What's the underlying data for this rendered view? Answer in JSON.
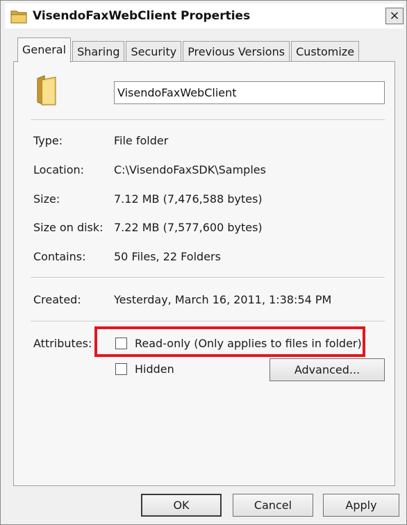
{
  "window": {
    "title": "VisendoFaxWebClient Properties",
    "close_label": "×",
    "title_icon": "folder-icon"
  },
  "tabs": [
    {
      "label": "General",
      "active": true
    },
    {
      "label": "Sharing",
      "active": false
    },
    {
      "label": "Security",
      "active": false
    },
    {
      "label": "Previous Versions",
      "active": false
    },
    {
      "label": "Customize",
      "active": false
    }
  ],
  "general": {
    "icon": "folder-icon",
    "name_value": "VisendoFaxWebClient",
    "properties": [
      {
        "label": "Type:",
        "value": "File folder"
      },
      {
        "label": "Location:",
        "value": "C:\\VisendoFaxSDK\\Samples"
      },
      {
        "label": "Size:",
        "value": "7.12 MB (7,476,588 bytes)"
      },
      {
        "label": "Size on disk:",
        "value": "7.22 MB (7,577,600 bytes)"
      },
      {
        "label": "Contains:",
        "value": "50 Files, 22 Folders"
      }
    ],
    "created": {
      "label": "Created:",
      "value": "Yesterday, March 16, 2011, 1:38:54 PM"
    },
    "attributes": {
      "label": "Attributes:",
      "readonly_label": "Read-only (Only applies to files in folder)",
      "readonly_checked": false,
      "hidden_label": "Hidden",
      "hidden_checked": false,
      "advanced_label": "Advanced..."
    },
    "highlight_color": "#e3161e"
  },
  "footer": {
    "ok_label": "OK",
    "cancel_label": "Cancel",
    "apply_label": "Apply"
  },
  "colors": {
    "dialog_bg": "#f0f0f0",
    "folder_yellow": "#e8c75a"
  }
}
